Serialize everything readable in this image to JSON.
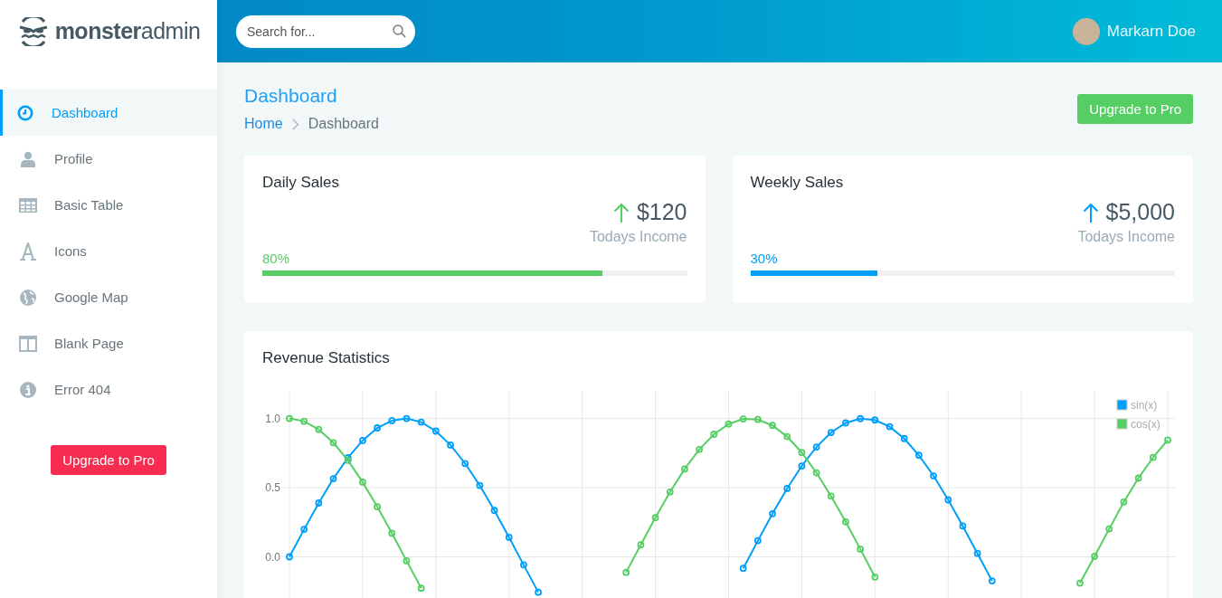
{
  "logo": {
    "bold": "monster",
    "light": "admin"
  },
  "search": {
    "placeholder": "Search for..."
  },
  "user": {
    "name": "Markarn Doe"
  },
  "sidebar": {
    "items": [
      {
        "label": "Dashboard",
        "selected": true
      },
      {
        "label": "Profile",
        "selected": false
      },
      {
        "label": "Basic Table",
        "selected": false
      },
      {
        "label": "Icons",
        "selected": false
      },
      {
        "label": "Google Map",
        "selected": false
      },
      {
        "label": "Blank Page",
        "selected": false
      },
      {
        "label": "Error 404",
        "selected": false
      }
    ],
    "button": "Upgrade to Pro"
  },
  "page_title": "Dashboard",
  "breadcrumb": [
    "Home",
    "Dashboard"
  ],
  "header_button": "Upgrade to Pro",
  "stat_cards": [
    {
      "title": "Daily Sales",
      "amount": "$120",
      "caption": "Todays Income",
      "percent": "80%",
      "level": 0.8,
      "color": "#55ce63"
    },
    {
      "title": "Weekly Sales",
      "amount": "$5,000",
      "caption": "Todays Income",
      "percent": "30%",
      "level": 0.3,
      "color": "#009efb"
    }
  ],
  "revenue": {
    "title": "Revenue Statistics",
    "chart_data": {
      "type": "line",
      "grid": true,
      "legend": true,
      "ylim": [
        -1.2,
        1.2
      ],
      "yticks": [
        {
          "value": 0,
          "label": "0.0"
        },
        {
          "value": 0.5,
          "label": "0.5"
        },
        {
          "value": 1,
          "label": "1.0"
        }
      ],
      "categories": [
        null,
        null,
        null,
        null,
        null,
        null,
        null,
        null,
        null,
        null,
        null,
        null,
        null,
        null,
        null,
        null,
        null,
        null,
        null,
        null,
        null,
        null,
        null,
        null,
        null,
        null,
        null,
        null,
        null,
        null,
        null,
        null,
        null,
        null,
        null,
        null,
        null,
        null,
        null,
        null,
        null,
        null,
        null,
        null,
        null,
        null,
        null,
        null,
        null,
        null,
        null,
        null,
        null,
        null,
        null,
        null,
        null,
        null,
        null,
        null,
        null
      ],
      "series": [
        {
          "name": "sin(x)",
          "color": "#009efb",
          "marker": "circle",
          "values": [
            0,
            0.199,
            0.389,
            0.565,
            0.717,
            0.841,
            0.932,
            0.985,
            1.0,
            0.974,
            0.909,
            0.808,
            0.675,
            0.516,
            0.335,
            0.141,
            -0.058,
            -0.256,
            null,
            null,
            null,
            null,
            null,
            null,
            null,
            null,
            null,
            null,
            null,
            null,
            null,
            -0.083,
            0.117,
            0.312,
            0.494,
            0.657,
            0.794,
            0.899,
            0.968,
            0.999,
            0.989,
            0.941,
            0.855,
            0.734,
            0.585,
            0.412,
            0.223,
            0.025,
            -0.174,
            null,
            null,
            null,
            null,
            null,
            null,
            null,
            null,
            null,
            null,
            null,
            null
          ]
        },
        {
          "name": "cos(x)",
          "color": "#55ce63",
          "marker": "circle",
          "values": [
            1,
            0.98,
            0.921,
            0.825,
            0.697,
            0.54,
            0.362,
            0.17,
            -0.029,
            -0.227,
            null,
            null,
            null,
            null,
            null,
            null,
            null,
            null,
            null,
            null,
            null,
            null,
            null,
            -0.112,
            0.087,
            0.284,
            0.469,
            0.635,
            0.776,
            0.886,
            0.96,
            0.997,
            0.993,
            0.95,
            0.869,
            0.754,
            0.608,
            0.439,
            0.253,
            0.056,
            -0.146,
            null,
            null,
            null,
            null,
            null,
            null,
            null,
            null,
            null,
            null,
            null,
            null,
            null,
            -0.19,
            0.004,
            0.202,
            0.397,
            0.569,
            0.718,
            0.844
          ]
        }
      ]
    }
  }
}
